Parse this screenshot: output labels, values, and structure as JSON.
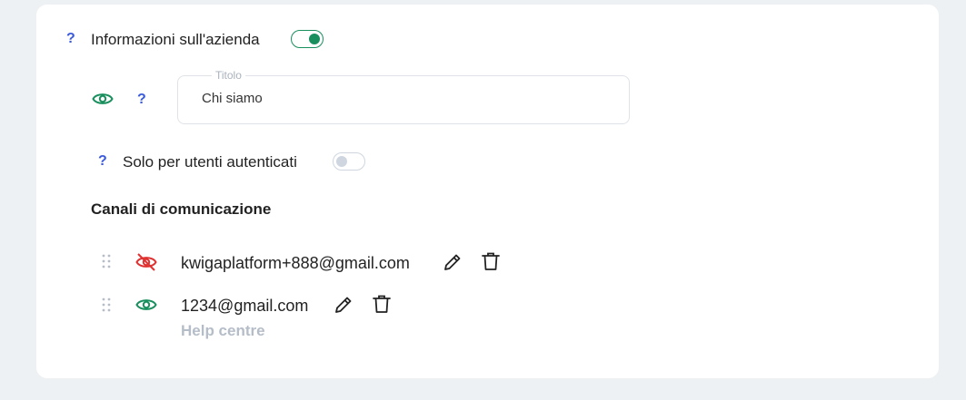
{
  "company_info": {
    "help_mark": "?",
    "label": "Informazioni sull'azienda",
    "toggle_on": true
  },
  "title_field": {
    "help_mark": "?",
    "legend": "Titolo",
    "value": "Chi siamo"
  },
  "auth_only": {
    "help_mark": "?",
    "label": "Solo per utenti autenticati",
    "toggle_on": false
  },
  "channels": {
    "title": "Canali di comunicazione",
    "items": [
      {
        "email": "kwigaplatform+888@gmail.com",
        "visibility_icon": "eye-off-icon",
        "visible": false
      },
      {
        "email": "1234@gmail.com",
        "visibility_icon": "eye-icon",
        "visible": true,
        "subtitle": "Help centre"
      }
    ]
  },
  "colors": {
    "accent_green": "#1a8f5e",
    "hidden_red": "#e03131",
    "help_blue": "#3b5bdb",
    "toggle_off": "#cfd6e0"
  }
}
